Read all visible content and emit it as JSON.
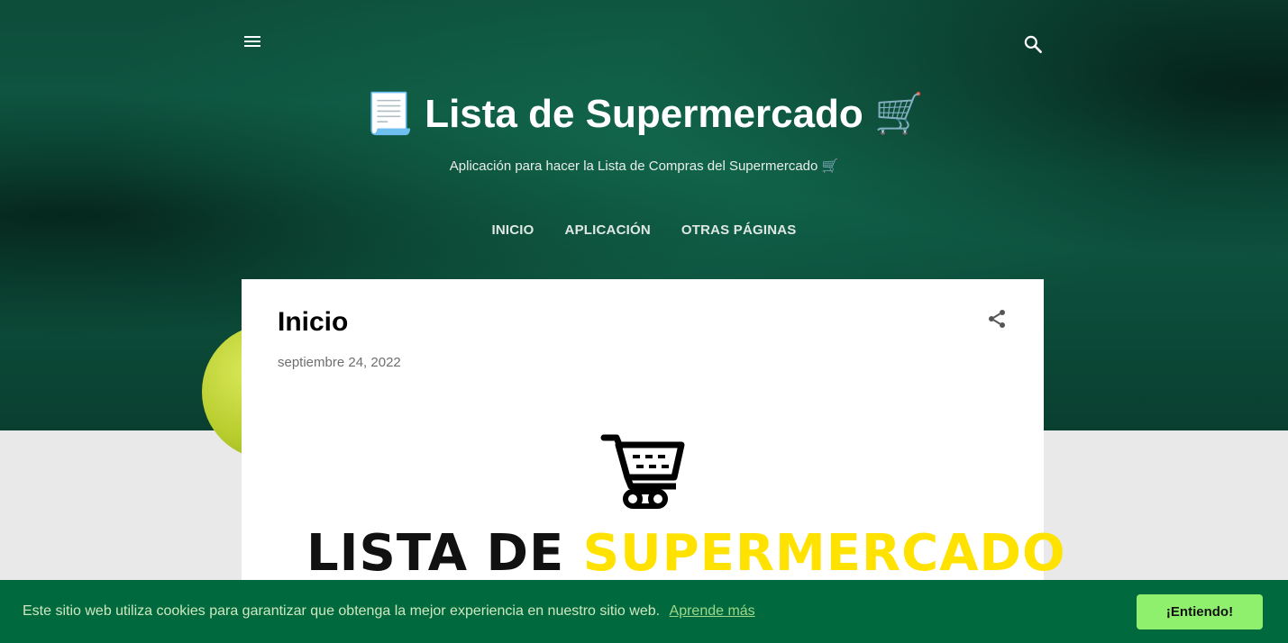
{
  "header": {
    "title_prefix_emoji": "📃",
    "title": "Lista de Supermercado",
    "title_suffix_emoji": "🛒",
    "description": "Aplicación para hacer la Lista de Compras del Supermercado 🛒",
    "icons": {
      "menu": "menu-icon",
      "search": "search-icon"
    }
  },
  "nav": {
    "items": [
      {
        "label": "INICIO"
      },
      {
        "label": "APLICACIÓN"
      },
      {
        "label": "OTRAS PÁGINAS"
      }
    ]
  },
  "post": {
    "title": "Inicio",
    "date": "septiembre 24, 2022",
    "share_icon": "share-icon",
    "logo": {
      "word_black": "LISTA DE",
      "word_yellow": "SUPERMERCADO",
      "icon": "shopping-cart-icon",
      "yellow_color": "#ffe200"
    }
  },
  "cookie": {
    "text": "Este sitio web utiliza cookies para garantizar que obtenga la mejor experiencia en nuestro sitio web.",
    "link": "Aprende más",
    "button": "¡Entiendo!",
    "bar_color": "#006a3e",
    "button_color": "#8ff06e"
  }
}
